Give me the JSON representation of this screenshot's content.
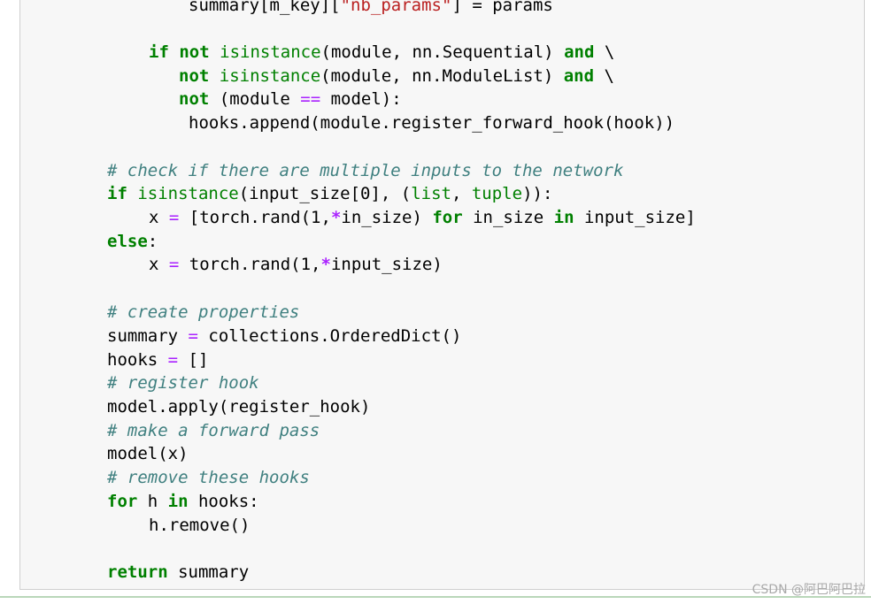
{
  "code_lines": [
    {
      "id": "l0",
      "text": "summary[m_key][\"nb_params\"] = params"
    },
    {
      "id": "l1",
      "text": "if not isinstance(module, nn.Sequential) and \\"
    },
    {
      "id": "l2",
      "text": "not isinstance(module, nn.ModuleList) and \\"
    },
    {
      "id": "l3",
      "text": "not (module == model):"
    },
    {
      "id": "l4",
      "text": "hooks.append(module.register_forward_hook(hook))"
    },
    {
      "id": "l5",
      "text": "# check if there are multiple inputs to the network"
    },
    {
      "id": "l6",
      "text": "if isinstance(input_size[0], (list, tuple)):"
    },
    {
      "id": "l7",
      "text": "x = [torch.rand(1,*in_size) for in_size in input_size]"
    },
    {
      "id": "l8",
      "text": "else:"
    },
    {
      "id": "l9",
      "text": "x = torch.rand(1,*input_size)"
    },
    {
      "id": "l10",
      "text": "# create properties"
    },
    {
      "id": "l11",
      "text": "summary = collections.OrderedDict()"
    },
    {
      "id": "l12",
      "text": "hooks = []"
    },
    {
      "id": "l13",
      "text": "# register hook"
    },
    {
      "id": "l14",
      "text": "model.apply(register_hook)"
    },
    {
      "id": "l15",
      "text": "# make a forward pass"
    },
    {
      "id": "l16",
      "text": "model(x)"
    },
    {
      "id": "l17",
      "text": "# remove these hooks"
    },
    {
      "id": "l18",
      "text": "for h in hooks:"
    },
    {
      "id": "l19",
      "text": "h.remove()"
    },
    {
      "id": "l20",
      "text": "return summary"
    }
  ],
  "tokens": {
    "l0": [
      [
        "summary[m_key][",
        ""
      ],
      [
        "\"nb_params\"",
        "str"
      ],
      [
        "] = params",
        ""
      ]
    ],
    "l1": [
      [
        "if",
        "kw"
      ],
      [
        " ",
        ""
      ],
      [
        "not",
        "kw"
      ],
      [
        " ",
        ""
      ],
      [
        "isinstance",
        "bi"
      ],
      [
        "(module, nn.Sequential) ",
        ""
      ],
      [
        "and",
        "kw"
      ],
      [
        " \\",
        ""
      ]
    ],
    "l2": [
      [
        "not",
        "kw"
      ],
      [
        " ",
        ""
      ],
      [
        "isinstance",
        "bi"
      ],
      [
        "(module, nn.ModuleList) ",
        ""
      ],
      [
        "and",
        "kw"
      ],
      [
        " \\",
        ""
      ]
    ],
    "l3": [
      [
        "not",
        "kw"
      ],
      [
        " (module ",
        ""
      ],
      [
        "==",
        "op2"
      ],
      [
        " model):",
        ""
      ]
    ],
    "l4": [
      [
        "hooks.append(module.register_forward_hook(hook))",
        ""
      ]
    ],
    "l5": [
      [
        "# check if there are multiple inputs to the network",
        "cm"
      ]
    ],
    "l6": [
      [
        "if",
        "kw"
      ],
      [
        " ",
        ""
      ],
      [
        "isinstance",
        "bi"
      ],
      [
        "(input_size[0], (",
        ""
      ],
      [
        "list",
        "bi"
      ],
      [
        ", ",
        ""
      ],
      [
        "tuple",
        "bi"
      ],
      [
        ")):",
        ""
      ]
    ],
    "l7": [
      [
        "x ",
        ""
      ],
      [
        "=",
        "op2"
      ],
      [
        " [torch.rand(1,",
        ""
      ],
      [
        "*",
        "op"
      ],
      [
        "in_size) ",
        ""
      ],
      [
        "for",
        "kw"
      ],
      [
        " in_size ",
        ""
      ],
      [
        "in",
        "kw"
      ],
      [
        " input_size]",
        ""
      ]
    ],
    "l8": [
      [
        "else",
        "kw"
      ],
      [
        ":",
        ""
      ]
    ],
    "l9": [
      [
        "x ",
        ""
      ],
      [
        "=",
        "op2"
      ],
      [
        " torch.rand(1,",
        ""
      ],
      [
        "*",
        "op"
      ],
      [
        "input_size)",
        ""
      ]
    ],
    "l10": [
      [
        "# create properties",
        "cm"
      ]
    ],
    "l11": [
      [
        "summary ",
        ""
      ],
      [
        "=",
        "op2"
      ],
      [
        " collections.OrderedDict()",
        ""
      ]
    ],
    "l12": [
      [
        "hooks ",
        ""
      ],
      [
        "=",
        "op2"
      ],
      [
        " []",
        ""
      ]
    ],
    "l13": [
      [
        "# register hook",
        "cm"
      ]
    ],
    "l14": [
      [
        "model.apply(register_hook)",
        ""
      ]
    ],
    "l15": [
      [
        "# make a forward pass",
        "cm"
      ]
    ],
    "l16": [
      [
        "model(x)",
        ""
      ]
    ],
    "l17": [
      [
        "# remove these hooks",
        "cm"
      ]
    ],
    "l18": [
      [
        "for",
        "kw"
      ],
      [
        " h ",
        ""
      ],
      [
        "in",
        "kw"
      ],
      [
        " hooks:",
        ""
      ]
    ],
    "l19": [
      [
        "h.remove()",
        ""
      ]
    ],
    "l20": [
      [
        "return",
        "kw"
      ],
      [
        " summary",
        ""
      ]
    ]
  },
  "colors": {
    "keyword": "#008000",
    "operator": "#aa22ff",
    "string": "#ba2121",
    "comment": "#408080",
    "cell_background": "#f7f7f7",
    "cell_border": "#cfcfcf"
  },
  "watermark": "CSDN @阿巴阿巴拉"
}
